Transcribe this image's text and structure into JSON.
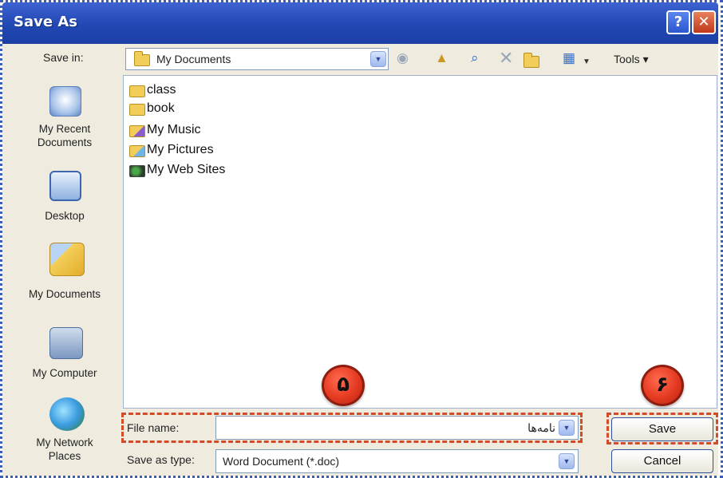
{
  "window": {
    "title": "Save As",
    "help_label": "?",
    "close_label": "✕"
  },
  "toolbar": {
    "save_in_label": "Save in:",
    "location": "My Documents",
    "tools_label": "Tools ▾"
  },
  "places": [
    {
      "label_line1": "My Recent",
      "label_line2": "Documents",
      "icon": "recent-documents-icon"
    },
    {
      "label_line1": "Desktop",
      "label_line2": "",
      "icon": "desktop-icon"
    },
    {
      "label_line1": "My Documents",
      "label_line2": "",
      "icon": "my-documents-icon"
    },
    {
      "label_line1": "My Computer",
      "label_line2": "",
      "icon": "my-computer-icon"
    },
    {
      "label_line1": "My Network",
      "label_line2": "Places",
      "icon": "network-places-icon"
    }
  ],
  "files": [
    {
      "name": "class",
      "icon": "folder-icon"
    },
    {
      "name": "book",
      "icon": "folder-icon"
    },
    {
      "name": "My Music",
      "icon": "music-folder-icon"
    },
    {
      "name": "My Pictures",
      "icon": "pictures-folder-icon"
    },
    {
      "name": "My Web Sites",
      "icon": "web-folder-icon"
    }
  ],
  "form": {
    "file_name_label": "File name:",
    "file_name_value": "نامه‌ها",
    "save_type_label": "Save as type:",
    "save_type_value": "Word Document (*.doc)"
  },
  "buttons": {
    "save": "Save",
    "cancel": "Cancel"
  },
  "callouts": {
    "step_5": "۵",
    "step_6": "۶"
  }
}
